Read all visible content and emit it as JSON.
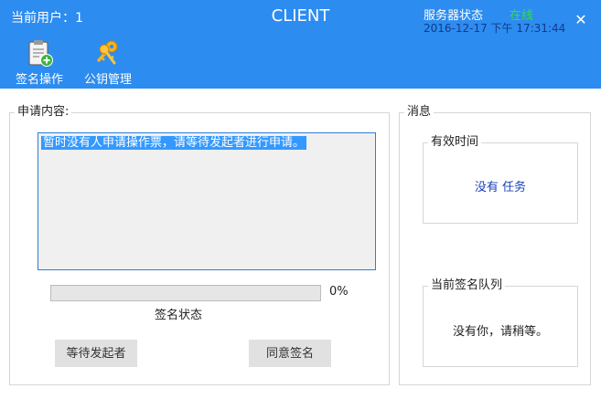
{
  "header": {
    "current_user_label": "当前用户：1",
    "title": "CLIENT",
    "server_status_label": "服务器状态",
    "server_status_value": "在线",
    "timestamp": "2016-12-17 下午 17:31:44",
    "close_icon": "close-icon",
    "close_glyph": "✕"
  },
  "toolbar": {
    "items": [
      {
        "label": "签名操作",
        "icon": "clipboard-add-icon"
      },
      {
        "label": "公钥管理",
        "icon": "keys-icon"
      }
    ]
  },
  "request": {
    "group_title": "申请内容:",
    "message": "暂时没有人申请操作票，请等待发起者进行申请。",
    "progress": 0,
    "progress_text": "0%",
    "status_label": "签名状态",
    "wait_button": "等待发起者",
    "agree_button": "同意签名"
  },
  "messages": {
    "group_title": "消息",
    "validity": {
      "title": "有效时间",
      "text": "没有 任务"
    },
    "queue": {
      "title": "当前签名队列",
      "text": "没有你，请稍等。"
    }
  },
  "colors": {
    "header_bg": "#2d8cf0",
    "online": "#2fe03a",
    "timestamp": "#123a8a",
    "selection": "#3399ff",
    "no_task_text": "#1a3fb8"
  }
}
